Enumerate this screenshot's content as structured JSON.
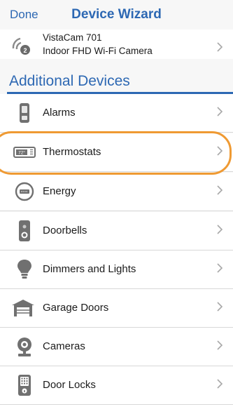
{
  "header": {
    "done_label": "Done",
    "title": "Device Wizard"
  },
  "vista": {
    "icon": "camera-wifi-icon",
    "line1": "VistaCam 701",
    "line2": "Indoor FHD Wi-Fi Camera"
  },
  "section": {
    "title": "Additional Devices"
  },
  "items": [
    {
      "label": "Alarms",
      "icon": "alarm-panel-icon"
    },
    {
      "label": "Thermostats",
      "icon": "thermostat-icon",
      "display": "72°"
    },
    {
      "label": "Energy",
      "icon": "energy-meter-icon"
    },
    {
      "label": "Doorbells",
      "icon": "doorbell-icon"
    },
    {
      "label": "Dimmers and Lights",
      "icon": "lightbulb-icon"
    },
    {
      "label": "Garage Doors",
      "icon": "garage-door-icon"
    },
    {
      "label": "Cameras",
      "icon": "camera-icon"
    },
    {
      "label": "Door Locks",
      "icon": "door-lock-icon"
    }
  ],
  "colors": {
    "accent": "#2d68b3",
    "highlight": "#ef9a33",
    "separator": "#d8d8d8"
  }
}
